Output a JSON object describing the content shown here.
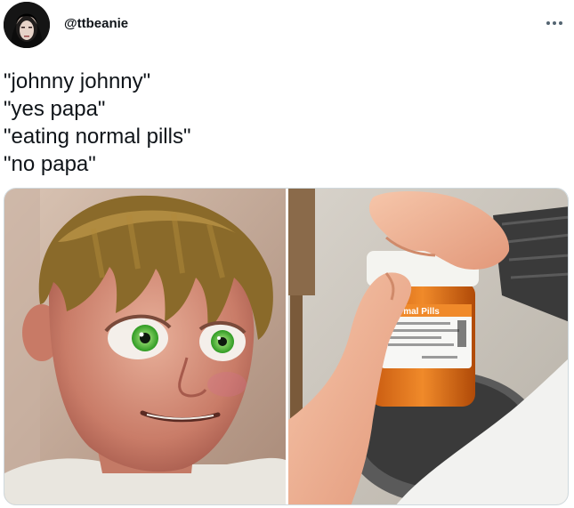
{
  "tweet": {
    "handle": "@ttbeanie",
    "lines": [
      "\"johnny johnny\"",
      "\"yes papa\"",
      "\"eating normal pills\"",
      "\"no papa\""
    ]
  },
  "media": {
    "left_image": "cartoon-boy-face",
    "right_image": "hand-opening-pill-bottle",
    "bottle_label": "Normal Pills"
  },
  "icons": {
    "more": "more-horizontal-icon",
    "avatar": "avatar"
  },
  "colors": {
    "text": "#0f1419",
    "border": "#cfd9de",
    "more_icon": "#536471",
    "bottle": "#e07a1c"
  }
}
